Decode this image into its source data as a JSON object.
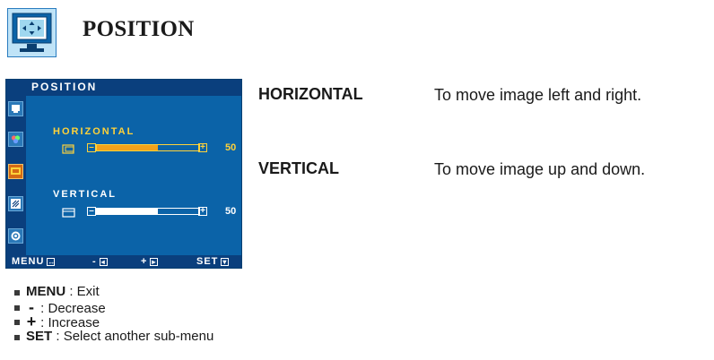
{
  "header": {
    "title": "POSITION",
    "icon": "monitor-position-icon"
  },
  "osd": {
    "title": "POSITION",
    "menu_icons": [
      "picture-icon",
      "color-icon",
      "position-icon",
      "tracking-icon",
      "setup-icon"
    ],
    "active_index": 2,
    "horizontal": {
      "label": "HORIZONTAL",
      "value": "50",
      "level_percent": 60
    },
    "vertical": {
      "label": "VERTICAL",
      "value": "50",
      "level_percent": 60
    },
    "footer": {
      "menu": "MENU",
      "minus": "-",
      "plus": "+",
      "set": "SET"
    },
    "colors": {
      "panel": "#0b63a8",
      "bar_dark": "#0a3f7d",
      "highlight": "#ffd23a",
      "active_fill": "#f3a21a"
    }
  },
  "descriptions": [
    {
      "term": "HORIZONTAL",
      "text": "To move image left and right."
    },
    {
      "term": "VERTICAL",
      "text": "To move image up and down."
    }
  ],
  "legend": [
    {
      "key": "MENU",
      "text": ": Exit"
    },
    {
      "key": "-",
      "text": ": Decrease"
    },
    {
      "key": "+",
      "text": ": Increase"
    },
    {
      "key": "SET",
      "text": ": Select another sub-menu"
    }
  ]
}
